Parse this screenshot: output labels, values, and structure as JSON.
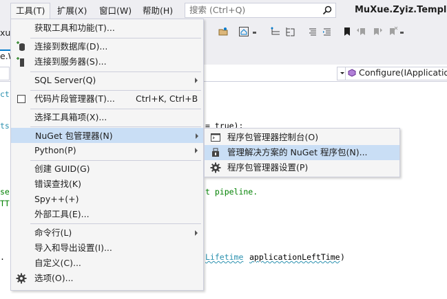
{
  "menubar": {
    "items": [
      {
        "label": "工具(T)"
      },
      {
        "label": "扩展(X)"
      },
      {
        "label": "窗口(W)"
      },
      {
        "label": "帮助(H)"
      }
    ],
    "search_placeholder": "搜索 (Ctrl+Q)",
    "solution_title": "MuXue.Zyiz.Template."
  },
  "toolbar": {
    "left_combo_text": "xue.zy"
  },
  "doc_tab": {
    "label": "e.W"
  },
  "navbar": {
    "right_text": "Configure(IApplication"
  },
  "code_lines": [
    {
      "text": "ct:",
      "color": "teal"
    },
    {
      "text": "ts",
      "color": "teal"
    },
    {
      "text": "= true);",
      "color": "black"
    },
    {
      "text": "se",
      "color": "green"
    },
    {
      "text": "TTE",
      "color": "green"
    },
    {
      "text": "t pipeline.",
      "color": "green"
    },
    {
      "text": ". I",
      "color": "black"
    },
    {
      "text": "Lifetime",
      "color": "teal"
    },
    {
      "text": "applicationLeftTime",
      "color": "black"
    },
    {
      "text": ")",
      "color": "black"
    }
  ],
  "tools_menu": {
    "items": [
      {
        "label": "获取工具和功能(T)...",
        "icon": null,
        "shortcut": "",
        "submenu": false
      },
      {
        "label": "连接到数据库(D)...",
        "icon": "database-plus-icon",
        "shortcut": "",
        "submenu": false
      },
      {
        "label": "连接到服务器(S)...",
        "icon": "server-plus-icon",
        "shortcut": "",
        "submenu": false
      },
      {
        "label": "SQL Server(Q)",
        "icon": null,
        "shortcut": "",
        "submenu": true
      },
      {
        "label": "代码片段管理器(T)...",
        "icon": "checkbox-icon",
        "shortcut": "Ctrl+K, Ctrl+B",
        "submenu": false
      },
      {
        "label": "选择工具箱项(X)...",
        "icon": null,
        "shortcut": "",
        "submenu": false
      },
      {
        "label": "NuGet 包管理器(N)",
        "icon": null,
        "shortcut": "",
        "submenu": true,
        "highlighted": true
      },
      {
        "label": "Python(P)",
        "icon": null,
        "shortcut": "",
        "submenu": true
      },
      {
        "label": "创建 GUID(G)",
        "icon": null,
        "shortcut": "",
        "submenu": false
      },
      {
        "label": "错误查找(K)",
        "icon": null,
        "shortcut": "",
        "submenu": false
      },
      {
        "label": "Spy++(+)",
        "icon": null,
        "shortcut": "",
        "submenu": false
      },
      {
        "label": "外部工具(E)...",
        "icon": null,
        "shortcut": "",
        "submenu": false
      },
      {
        "label": "命令行(L)",
        "icon": null,
        "shortcut": "",
        "submenu": true
      },
      {
        "label": "导入和导出设置(I)...",
        "icon": null,
        "shortcut": "",
        "submenu": false
      },
      {
        "label": "自定义(C)...",
        "icon": null,
        "shortcut": "",
        "submenu": false
      },
      {
        "label": "选项(O)...",
        "icon": "gear-icon",
        "shortcut": "",
        "submenu": false
      }
    ]
  },
  "nuget_submenu": {
    "items": [
      {
        "label": "程序包管理器控制台(O)",
        "icon": "console-icon"
      },
      {
        "label": "管理解决方案的 NuGet 程序包(N)...",
        "icon": "package-icon",
        "highlighted": true
      },
      {
        "label": "程序包管理器设置(P)",
        "icon": "gear-icon"
      }
    ]
  },
  "colors": {
    "menu_bg": "#f5f5f5",
    "highlight": "#c9def5",
    "chrome_bg": "#eeeef2",
    "border": "#cccedb",
    "accent": "#007acc"
  }
}
